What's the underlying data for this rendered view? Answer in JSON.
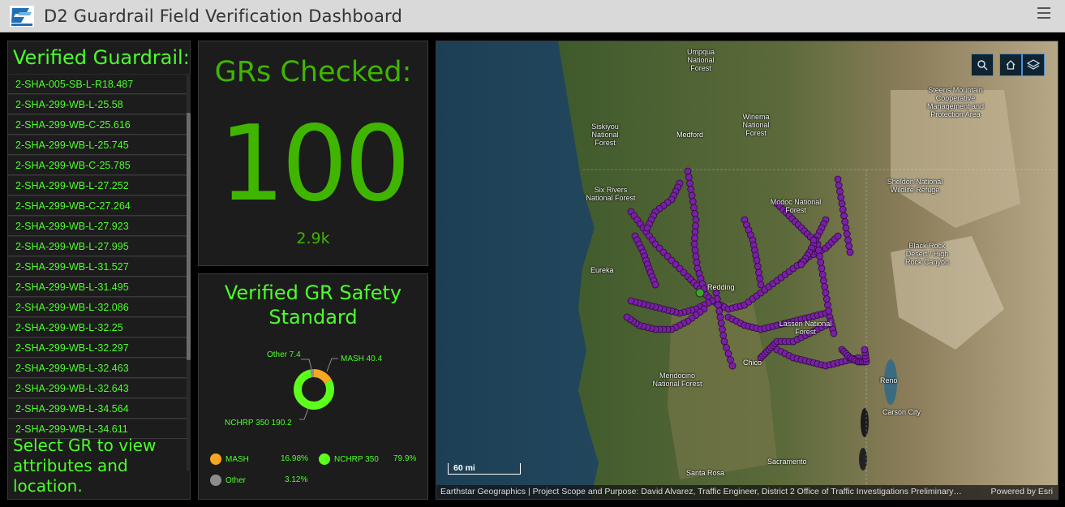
{
  "header": {
    "title": "D2 Guardrail Field Verification Dashboard",
    "logo_text": "Caltrans",
    "menu_icon": "hamburger-menu-icon"
  },
  "list_panel": {
    "title": "Verified Guardrail:",
    "items": [
      "2-SHA-005-SB-L-R18.487",
      "2-SHA-299-WB-L-25.58",
      "2-SHA-299-WB-C-25.616",
      "2-SHA-299-WB-L-25.745",
      "2-SHA-299-WB-C-25.785",
      "2-SHA-299-WB-L-27.252",
      "2-SHA-299-WB-C-27.264",
      "2-SHA-299-WB-L-27.923",
      "2-SHA-299-WB-L-27.995",
      "2-SHA-299-WB-L-31.527",
      "2-SHA-299-WB-L-31.495",
      "2-SHA-299-WB-L-32.086",
      "2-SHA-299-WB-L-32.25",
      "2-SHA-299-WB-L-32.297",
      "2-SHA-299-WB-L-32.463",
      "2-SHA-299-WB-L-32.643",
      "2-SHA-299-WB-L-34.564",
      "2-SHA-299-WB-L-34.611"
    ],
    "footer": "Select GR to view attributes and location."
  },
  "indicator": {
    "title": "GRs Checked:",
    "value": "100",
    "sub_value": "2.9k"
  },
  "pie_panel": {
    "title_line1": "Verified GR Safety",
    "title_line2": "Standard",
    "legend": [
      {
        "name": "MASH",
        "pct": "16.98%",
        "color": "#f5a623"
      },
      {
        "name": "NCHRP 350",
        "pct": "79.9%",
        "color": "#5cff1a"
      },
      {
        "name": "Other",
        "pct": "3.12%",
        "color": "#8c8c8c"
      }
    ],
    "labels": {
      "other": "Other 7.4",
      "mash": "MASH 40.4",
      "nchrp": "NCHRP 350 190.2"
    }
  },
  "chart_data": {
    "type": "pie",
    "title": "Verified GR Safety Standard",
    "categories": [
      "MASH",
      "NCHRP 350",
      "Other"
    ],
    "values": [
      40.4,
      190.2,
      7.4
    ],
    "percentages": [
      16.98,
      79.9,
      3.12
    ],
    "colors": [
      "#f5a623",
      "#5cff1a",
      "#8c8c8c"
    ],
    "legend": "bottom"
  },
  "map": {
    "buttons": [
      "search-icon",
      "home-icon",
      "layers-icon"
    ],
    "scale_label": "60 mi",
    "attribution": "Earthstar Geographics | Project Scope and Purpose: David Alvarez, Traffic Engineer, District 2 Office of Traffic Investigations Preliminary…",
    "powered_by": "Powered by Esri",
    "places": {
      "umpqua": "Umpqua National Forest",
      "steens": "Steens Mountain Cooperative Management and Protection Area",
      "siskiyou": "Siskiyou National Forest",
      "winema": "Winema National Forest",
      "medford": "Medford",
      "sheldon": "Sheldon National Wildlife Refuge",
      "sixrivers": "Six Rivers National Forest",
      "modoc": "Modoc National Forest",
      "blackrock": "Black Rock Desert / High Rock Canyon",
      "eureka": "Eureka",
      "redding": "Redding",
      "lassen": "Lassen National Forest",
      "chico": "Chico",
      "mendocino": "Mendocino National Forest",
      "reno": "Reno",
      "carson": "Carson City",
      "sacramento": "Sacramento",
      "santarosa": "Santa Rosa"
    }
  }
}
